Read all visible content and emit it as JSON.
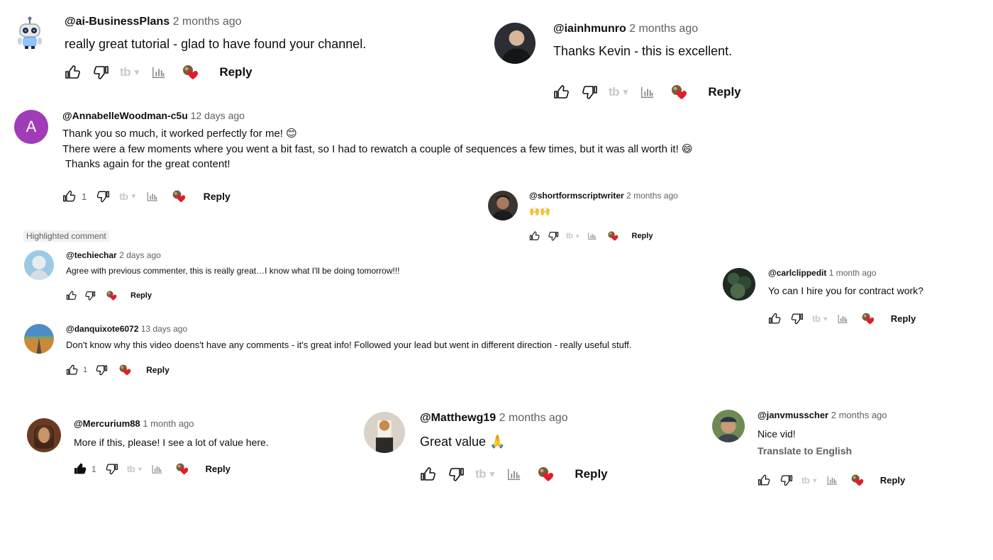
{
  "highlighted_label": "Highlighted comment",
  "reply_label": "Reply",
  "icons": {
    "like": "thumbs-up-icon",
    "dislike": "thumbs-down-icon",
    "tubebuddy": "tubebuddy-icon",
    "analytics": "bar-chart-icon",
    "creator_heart": "creator-heart-icon"
  },
  "colors": {
    "heart": "#e11d2a",
    "muted": "#606060",
    "tubebuddy": "#c8c8c8",
    "avatar_purple": "#a13cb8"
  },
  "comments": [
    {
      "handle": "@ai-BusinessPlans",
      "time": "2 months ago",
      "lines": [
        "really great tutorial - glad to have found your channel."
      ],
      "likes": "",
      "translate": ""
    },
    {
      "handle": "@iainhmunro",
      "time": "2 months ago",
      "lines": [
        "Thanks Kevin - this is excellent."
      ],
      "likes": "",
      "translate": ""
    },
    {
      "handle": "@AnnabelleWoodman-c5u",
      "time": "12 days ago",
      "avatar_letter": "A",
      "lines": [
        "Thank you so much, it worked perfectly for me! 😊",
        "There were a few moments where you went a bit fast, so I had to rewatch a couple of sequences a few times, but it was all worth it! 😄",
        " Thanks again for the great content!"
      ],
      "likes": "1",
      "translate": ""
    },
    {
      "handle": "@shortformscriptwriter",
      "time": "2 months ago",
      "lines": [
        "🙌🙌"
      ],
      "likes": "",
      "translate": ""
    },
    {
      "handle": "@techiechar",
      "time": "2 days ago",
      "lines": [
        "Agree with previous commenter, this is really great…I know what I'll be doing tomorrow!!!"
      ],
      "likes": "",
      "translate": ""
    },
    {
      "handle": "@carlclippedit",
      "time": "1 month ago",
      "lines": [
        "Yo can I hire you for contract work?"
      ],
      "likes": "",
      "translate": ""
    },
    {
      "handle": "@danquixote6072",
      "time": "13 days ago",
      "lines": [
        "Don't know why this video doens't have any comments - it's great info! Followed your lead but went in different direction - really useful stuff."
      ],
      "likes": "1",
      "translate": ""
    },
    {
      "handle": "@Mercurium88",
      "time": "1 month ago",
      "lines": [
        "More if this, please! I see a lot of value here."
      ],
      "likes": "1",
      "liked": true,
      "translate": ""
    },
    {
      "handle": "@Matthewg19",
      "time": "2 months ago",
      "lines": [
        "Great value 🙏"
      ],
      "likes": "",
      "translate": ""
    },
    {
      "handle": "@janvmusscher",
      "time": "2 months ago",
      "lines": [
        "Nice vid!"
      ],
      "likes": "",
      "translate": "Translate to English"
    }
  ]
}
